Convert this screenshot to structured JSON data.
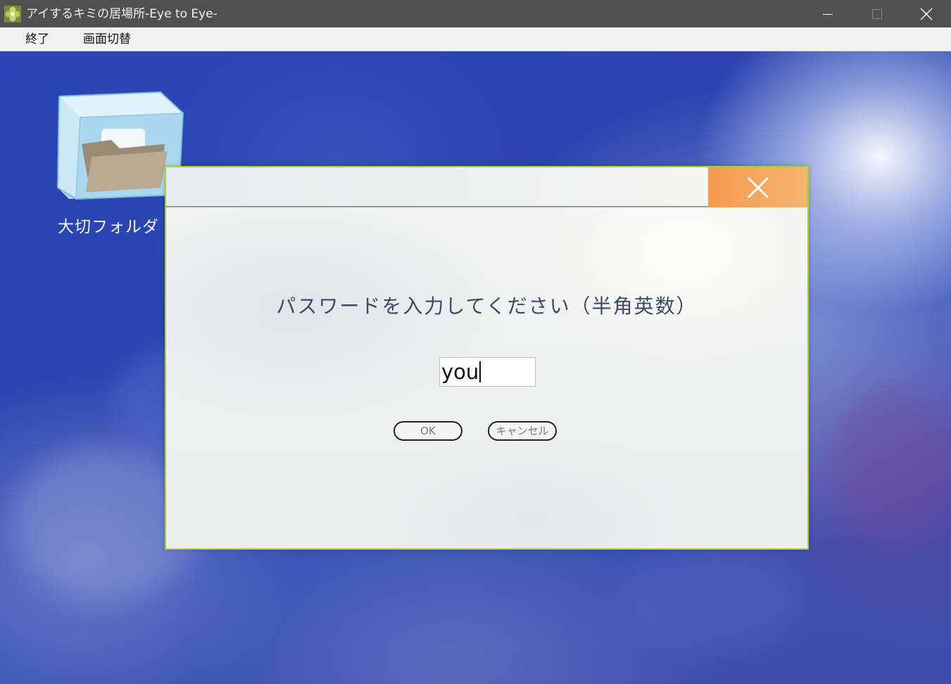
{
  "window": {
    "title": "アイするキミの居場所-Eye to Eye-",
    "icon": "app-icon",
    "controls": [
      "minimize-icon",
      "maximize-icon",
      "close-icon"
    ]
  },
  "menu": {
    "items": [
      {
        "label": "終了"
      },
      {
        "label": "画面切替"
      }
    ]
  },
  "desktop": {
    "icons": [
      {
        "label": "大切フォルダ",
        "icon": "ice-folder-icon"
      }
    ]
  },
  "dialog": {
    "prompt": "パスワードを入力してください（半角英数）",
    "password_value": "you",
    "ok_label": "OK",
    "cancel_label": "キャンセル",
    "close_icon": "close-icon",
    "colors": {
      "border": "#a6cf3a",
      "close_button": "#f39a4e",
      "prompt_text": "#3b4a66"
    }
  }
}
